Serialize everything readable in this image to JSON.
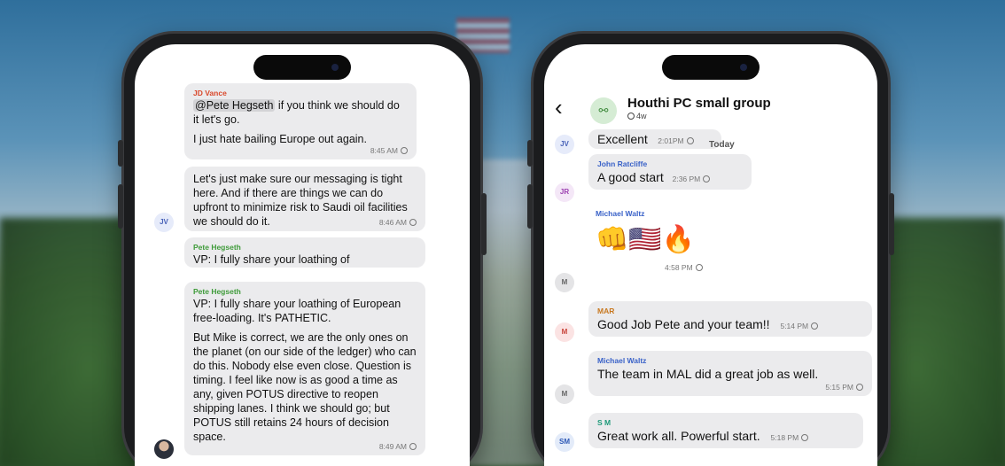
{
  "left_chat": {
    "messages": [
      {
        "sender": "JD Vance",
        "mention": "@Pete Hegseth",
        "text_after_mention": " if you think we should do it let's go.",
        "text2": "I just hate bailing Europe out again.",
        "time": "8:45 AM"
      },
      {
        "text": "Let's just make sure our messaging is tight here. And if there are things we can do upfront to minimize risk to Saudi oil facilities we should do it.",
        "time": "8:46 AM",
        "avatar": "JV"
      },
      {
        "sender": "Pete Hegseth",
        "text": "VP: I fully share your loathing of"
      },
      {
        "sender": "Pete Hegseth",
        "text": "VP: I fully share your loathing of European free-loading. It's PATHETIC.",
        "text2": "But Mike is correct, we are the only ones on the planet (on our side of the ledger) who can do this. Nobody else even close. Question is timing. I feel like now is as good a time as any, given POTUS directive to reopen shipping lanes. I think we should go; but POTUS still retains 24 hours of decision space.",
        "time": "8:49 AM"
      }
    ]
  },
  "right_chat": {
    "header": {
      "back_icon": "chevron-left-icon",
      "title": "Houthi PC small group",
      "subtitle": "4w",
      "group_icon": "people-icon"
    },
    "today_label": "Today",
    "messages": [
      {
        "avatar": "JV",
        "text": "Excellent",
        "time": "2:01PM"
      },
      {
        "avatar": "JR",
        "sender": "John Ratcliffe",
        "text": "A good start",
        "time": "2:36 PM"
      },
      {
        "avatar": "M",
        "sender": "Michael Waltz",
        "emoji": "👊🇺🇸🔥",
        "time": "4:58 PM"
      },
      {
        "avatar": "M",
        "sender": "MAR",
        "text": "Good Job Pete and your team!!",
        "time": "5:14 PM"
      },
      {
        "avatar": "M",
        "sender": "Michael Waltz",
        "text": "The team in MAL did a great job  as well.",
        "time": "5:15 PM"
      },
      {
        "avatar": "SM",
        "sender": "S M",
        "text": "Great work all. Powerful start.",
        "time": "5:18 PM"
      }
    ]
  }
}
